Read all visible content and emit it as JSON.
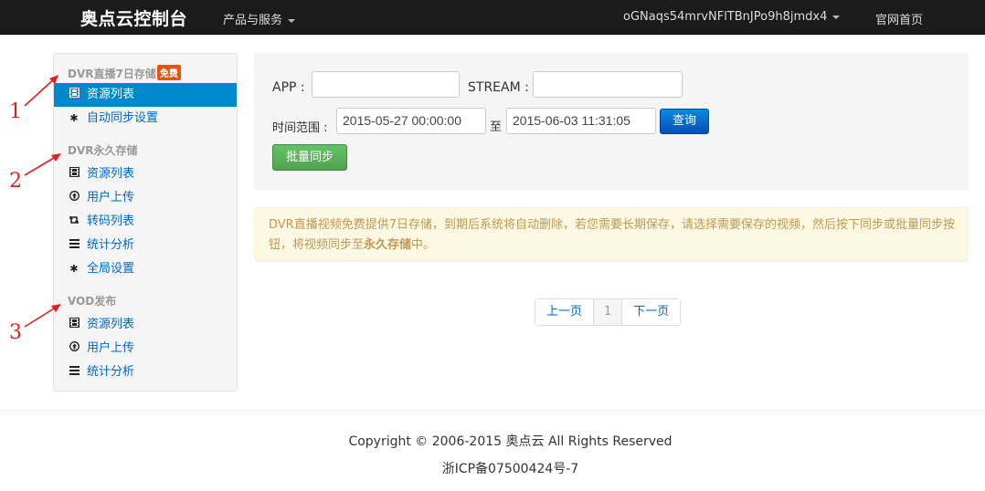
{
  "navbar": {
    "brand": "奥点云控制台",
    "products_menu": "产品与服务",
    "user": "oGNaqs54mrvNFlTBnJPo9h8jmdx4",
    "home_link": "官网首页"
  },
  "sidebar": {
    "sections": [
      {
        "header": "DVR直播7日存储",
        "badge": "免费",
        "items": [
          {
            "label": "资源列表",
            "icon": "film-icon",
            "active": true
          },
          {
            "label": "自动同步设置",
            "icon": "gear-icon",
            "active": false
          }
        ]
      },
      {
        "header": "DVR永久存储",
        "items": [
          {
            "label": "资源列表",
            "icon": "film-icon"
          },
          {
            "label": "用户上传",
            "icon": "upload-icon"
          },
          {
            "label": "转码列表",
            "icon": "retweet-icon"
          },
          {
            "label": "统计分析",
            "icon": "list-icon"
          },
          {
            "label": "全局设置",
            "icon": "gear-icon"
          }
        ]
      },
      {
        "header": "VOD发布",
        "items": [
          {
            "label": "资源列表",
            "icon": "film-icon"
          },
          {
            "label": "用户上传",
            "icon": "upload-icon"
          },
          {
            "label": "统计分析",
            "icon": "list-icon"
          }
        ]
      }
    ]
  },
  "annotations": [
    "1",
    "2",
    "3"
  ],
  "search": {
    "app_label": "APP :",
    "app_value": "",
    "stream_label": "STREAM :",
    "stream_value": "",
    "time_label": "时间范围 :",
    "start_time": "2015-05-27 00:00:00",
    "to_label": "至",
    "end_time": "2015-06-03 11:31:05",
    "query_button": "查询",
    "batch_sync_button": "批量同步"
  },
  "alert": {
    "text_part1": "DVR直播视频免费提供7日存储，到期后系统将自动删除，若您需要长期保存，请选择需要保存的视频，然后按下同步或批量同步按钮，将视频同步至",
    "text_bold": "永久存储",
    "text_part2": "中。"
  },
  "pagination": {
    "prev": "上一页",
    "current": "1",
    "next": "下一页"
  },
  "footer": {
    "copyright": "Copyright © 2006-2015 奥点云 All Rights Reserved",
    "icp": "浙ICP备07500424号-7"
  },
  "colors": {
    "navbar_bg": "#1b1b1b",
    "active_item": "#0088cc",
    "link": "#0066cc",
    "badge": "#e8520f",
    "annotation": "#e0201a",
    "query_button": "#0550b5",
    "sync_button": "#51a351",
    "alert_bg": "#fcf8e3",
    "alert_text": "#c09853"
  }
}
